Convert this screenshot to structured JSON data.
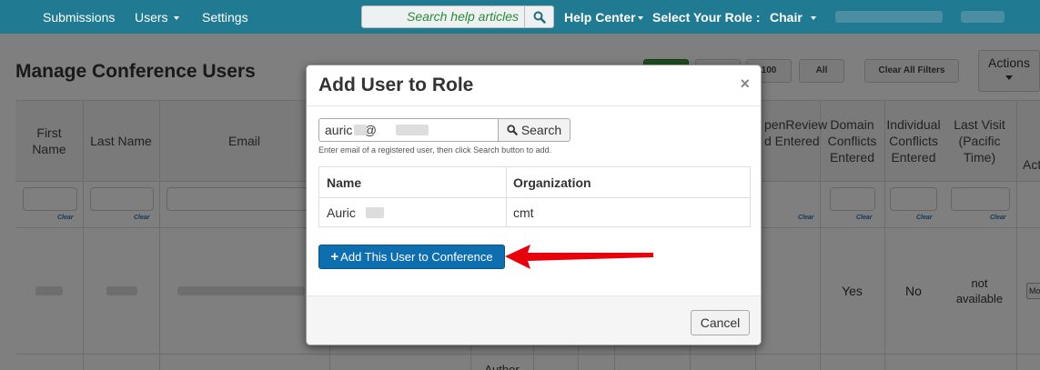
{
  "nav": {
    "submissions": "Submissions",
    "users": "Users",
    "settings": "Settings",
    "search_placeholder": "Search help articles",
    "help_center": "Help Center",
    "select_role": "Select Your Role :",
    "role": "Chair"
  },
  "page": {
    "title": "Manage Conference Users",
    "filters": {
      "f100": "100",
      "all": "All",
      "clear_all": "Clear All Filters"
    },
    "actions": "Actions",
    "columns": {
      "first_name": [
        "First",
        "Name"
      ],
      "last_name": "Last Name",
      "email": "Email",
      "openreview": [
        "penReview",
        "d Entered"
      ],
      "domain": [
        "Domain",
        "Conflicts",
        "Entered"
      ],
      "individual": [
        "Individual",
        "Conflicts",
        "Entered"
      ],
      "last_visit": [
        "Last Visit",
        "(Pacific",
        "Time)"
      ],
      "actions_partial": "Act"
    },
    "clear_label": "Clear",
    "row": {
      "domain_conflicts": "Yes",
      "individual_conflicts": "No",
      "last_visit": [
        "not",
        "available"
      ],
      "more_button": "Mo"
    },
    "next_row_partial": "Author"
  },
  "modal": {
    "title": "Add User to Role",
    "close": "×",
    "email_value": "auric  r@",
    "search_button": "Search",
    "help_text": "Enter email of a registered user, then click Search button to add.",
    "table": {
      "headers": [
        "Name",
        "Organization"
      ],
      "rows": [
        {
          "name": "Auric",
          "organization": "cmt"
        }
      ]
    },
    "add_button": "Add This User to Conference",
    "cancel_button": "Cancel"
  },
  "colors": {
    "nav_bg": "#1f7a92",
    "primary_btn": "#0e6fb0",
    "arrow": "#e8000b"
  }
}
